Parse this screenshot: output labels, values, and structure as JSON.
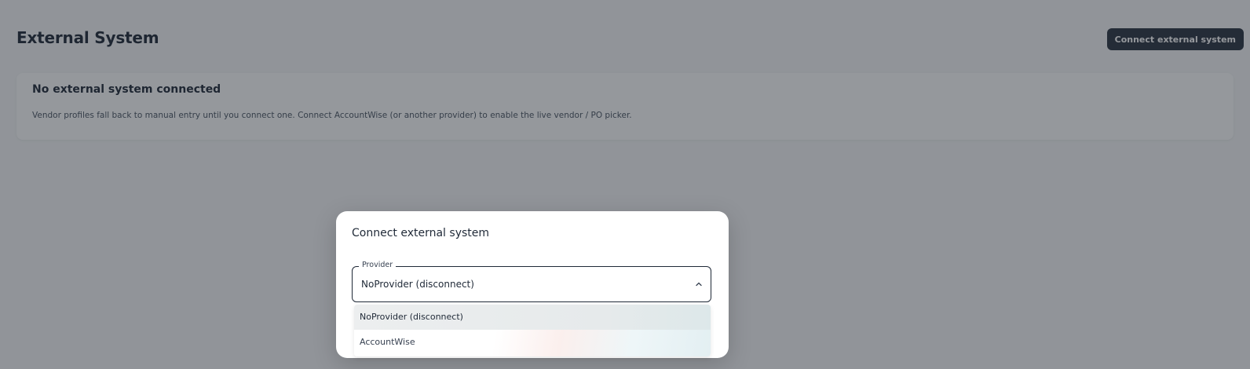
{
  "header": {
    "title": "External System",
    "connect_button_label": "Connect external system"
  },
  "status_card": {
    "title": "No external system connected",
    "description": "Vendor profiles fall back to manual entry until you connect one. Connect AccountWise (or another provider) to enable the live vendor / PO picker."
  },
  "dialog": {
    "title": "Connect external system",
    "provider_select": {
      "label": "Provider",
      "value": "NoProvider (disconnect)",
      "icon": "chevron-up-icon",
      "options": [
        {
          "label": "NoProvider (disconnect)",
          "selected": true
        },
        {
          "label": "AccountWise",
          "selected": false
        }
      ]
    }
  },
  "colors": {
    "primary_button": "#2b3340",
    "text_primary": "#1f2937",
    "overlay": "rgba(30, 36, 44, 0.47)"
  }
}
